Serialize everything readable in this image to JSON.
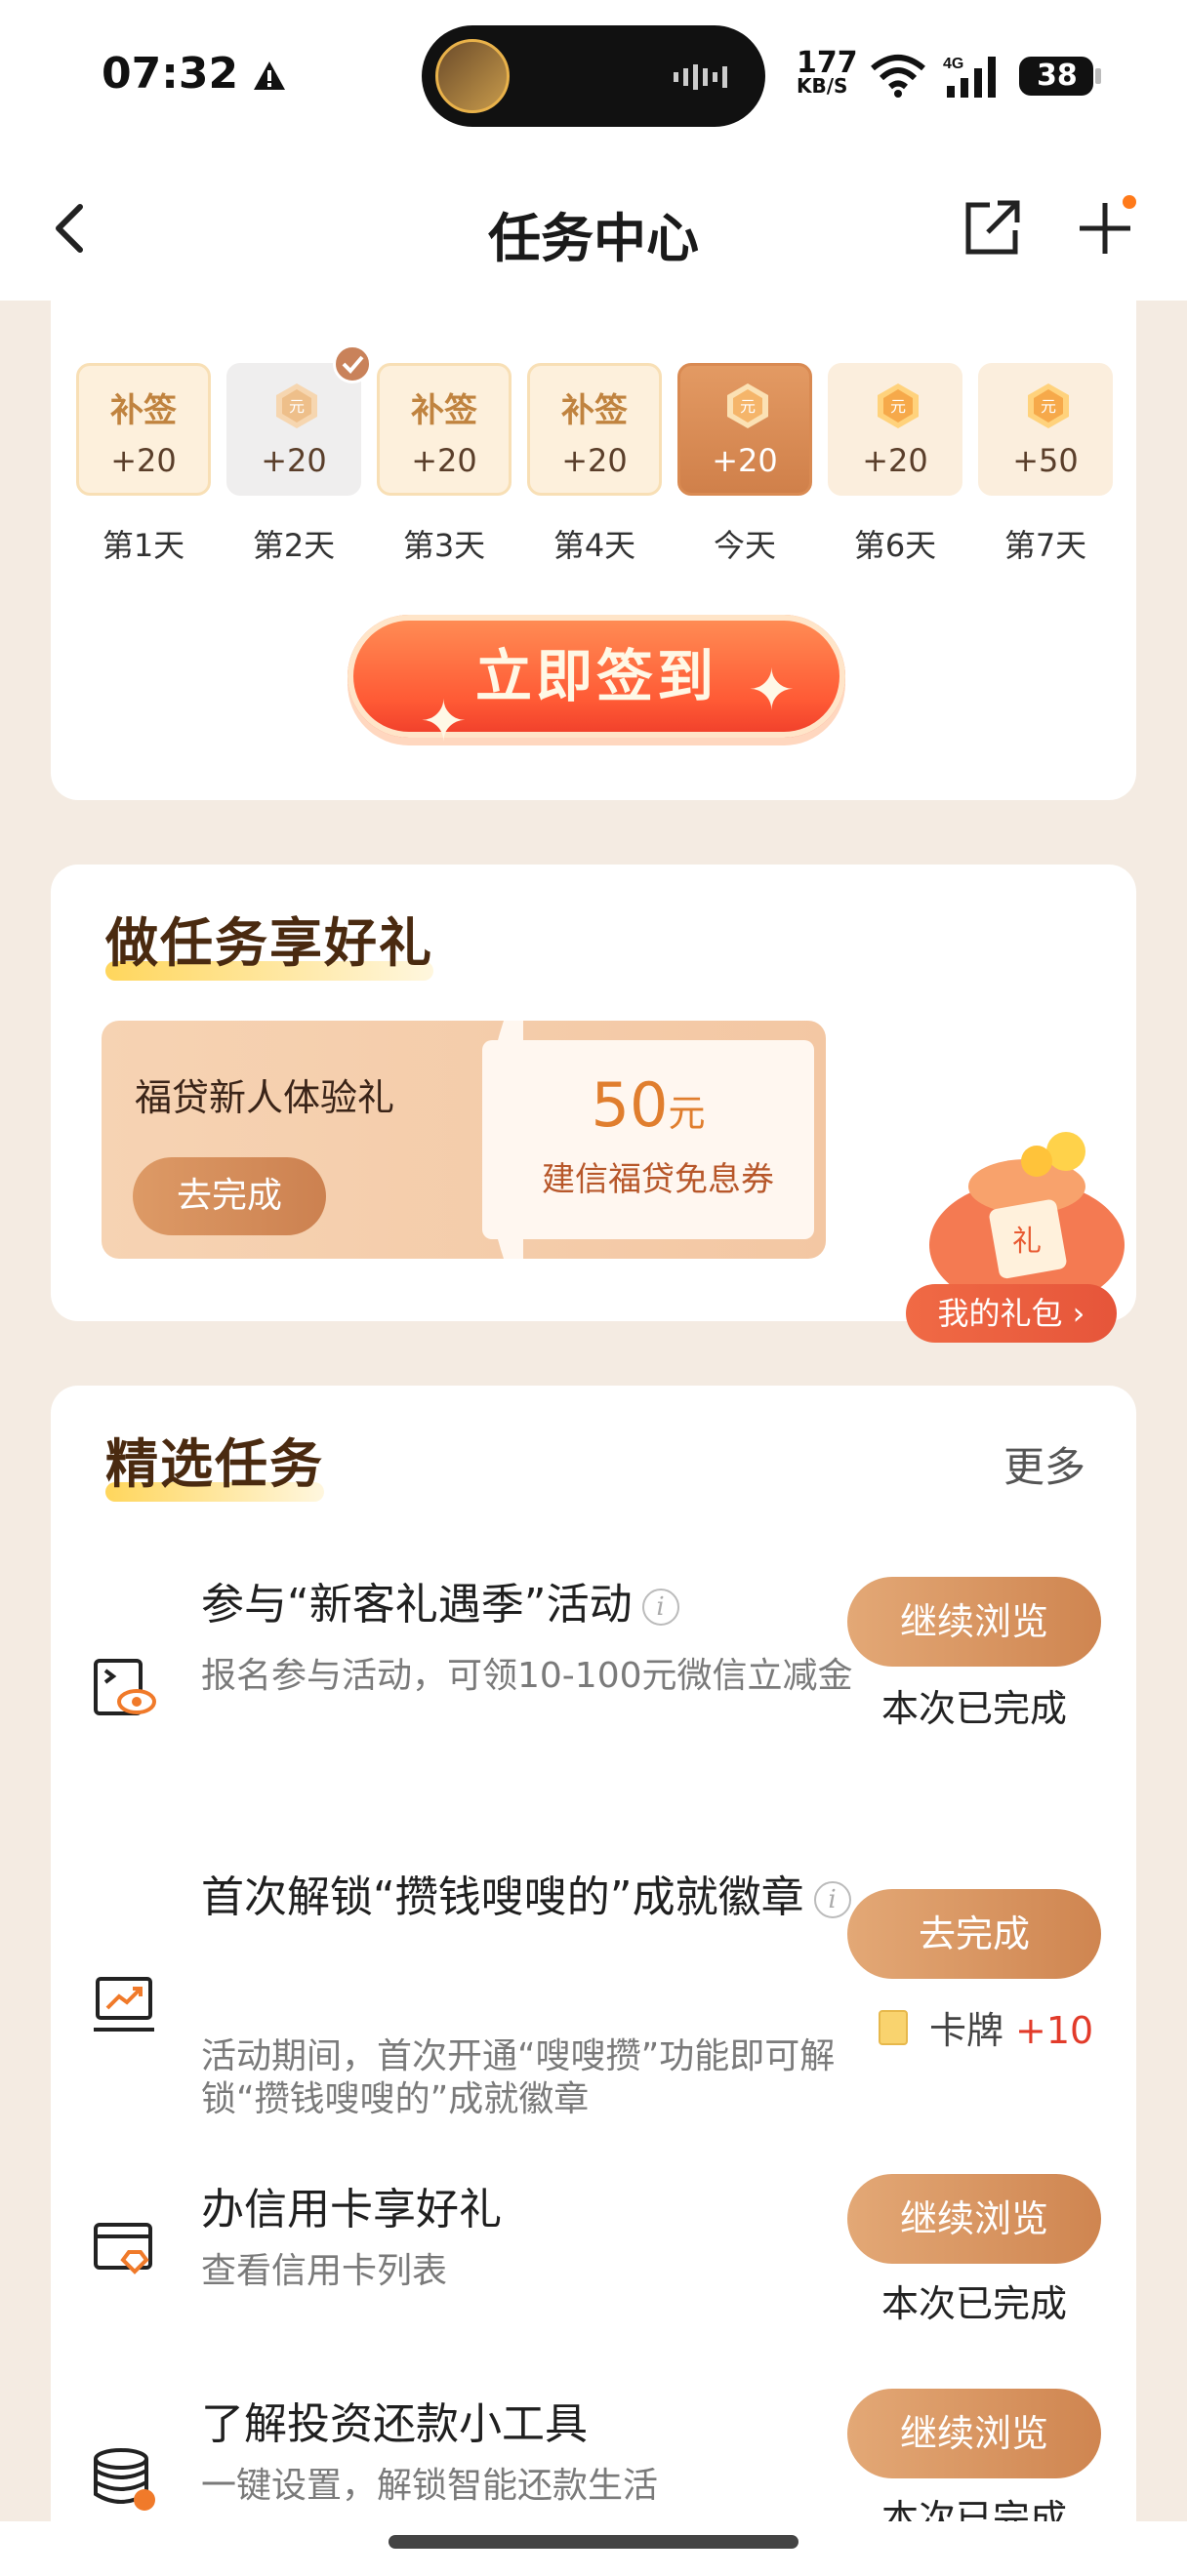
{
  "status_bar": {
    "time": "07:32",
    "speed_value": "177",
    "speed_unit": "KB/S",
    "network": "4G",
    "battery": "38"
  },
  "nav": {
    "title": "任务中心"
  },
  "signin": {
    "days": [
      {
        "label": "第1天",
        "patch": "补签",
        "amount": "+20",
        "state": "patch"
      },
      {
        "label": "第2天",
        "patch": "",
        "amount": "+20",
        "state": "done"
      },
      {
        "label": "第3天",
        "patch": "补签",
        "amount": "+20",
        "state": "patch"
      },
      {
        "label": "第4天",
        "patch": "补签",
        "amount": "+20",
        "state": "patch"
      },
      {
        "label": "今天",
        "patch": "",
        "amount": "+20",
        "state": "today"
      },
      {
        "label": "第6天",
        "patch": "",
        "amount": "+20",
        "state": "future"
      },
      {
        "label": "第7天",
        "patch": "",
        "amount": "+50",
        "state": "future"
      }
    ],
    "button_label": "立即签到"
  },
  "gift": {
    "title": "做任务享好礼",
    "promo_name": "福贷新人体验礼",
    "promo_button": "去完成",
    "coupon_value": "50",
    "coupon_unit": "元",
    "coupon_desc": "建信福贷免息券",
    "my_gift_label": "我的礼包 ›"
  },
  "tasks": {
    "title": "精选任务",
    "more_label": "更多",
    "items": [
      {
        "title": "参与“新客礼遇季”活动",
        "desc": "报名参与活动，可领10-100元微信立减金",
        "button": "继续浏览",
        "status": "本次已完成",
        "icon": "browse-eye-icon"
      },
      {
        "title": "首次解锁“攒钱嗖嗖的”成就徽章",
        "desc": "活动期间，首次开通“嗖嗖攒”功能即可解锁“攒钱嗖嗖的”成就徽章",
        "button": "去完成",
        "reward_label": "卡牌",
        "reward_value": "+10",
        "icon": "trend-chart-icon"
      },
      {
        "title": "办信用卡享好礼",
        "desc": "查看信用卡列表",
        "button": "继续浏览",
        "status": "本次已完成",
        "icon": "credit-card-icon"
      },
      {
        "title": "了解投资还款小工具",
        "desc": "一键设置，解锁智能还款生活",
        "button": "继续浏览",
        "status": "本次已完成",
        "icon": "coin-stack-icon"
      }
    ]
  },
  "colors": {
    "accent": "#cf8550",
    "primary_button": "#ff5a35",
    "reward_red": "#e23b2a",
    "background": "#f4ebe2"
  }
}
